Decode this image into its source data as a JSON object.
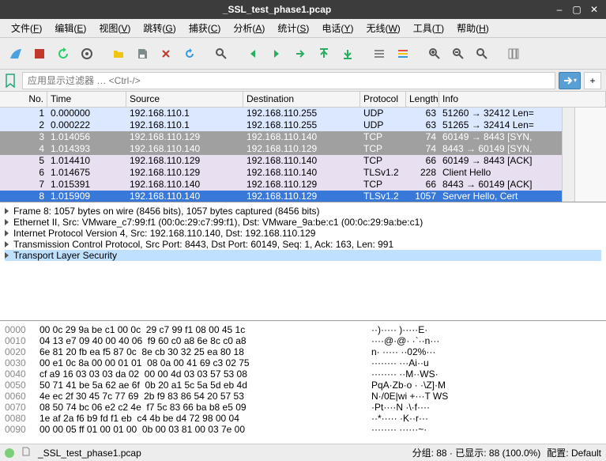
{
  "title": "_SSL_test_phase1.pcap",
  "window_btns": {
    "min": "–",
    "max": "▢",
    "close": "✕"
  },
  "menus": [
    {
      "label": "文件",
      "key": "F"
    },
    {
      "label": "编辑",
      "key": "E"
    },
    {
      "label": "视图",
      "key": "V"
    },
    {
      "label": "跳转",
      "key": "G"
    },
    {
      "label": "捕获",
      "key": "C"
    },
    {
      "label": "分析",
      "key": "A"
    },
    {
      "label": "统计",
      "key": "S"
    },
    {
      "label": "电话",
      "key": "Y"
    },
    {
      "label": "无线",
      "key": "W"
    },
    {
      "label": "工具",
      "key": "T"
    },
    {
      "label": "帮助",
      "key": "H"
    }
  ],
  "filter_placeholder": "应用显示过滤器 … <Ctrl-/>",
  "columns": {
    "no": "No.",
    "time": "Time",
    "src": "Source",
    "dst": "Destination",
    "proto": "Protocol",
    "len": "Length",
    "info": "Info"
  },
  "packets": [
    {
      "no": 1,
      "time": "0.000000",
      "src": "192.168.110.1",
      "dst": "192.168.110.255",
      "proto": "UDP",
      "len": 63,
      "info": "51260 → 32412 Len=",
      "cls": "row-udp"
    },
    {
      "no": 2,
      "time": "0.000222",
      "src": "192.168.110.1",
      "dst": "192.168.110.255",
      "proto": "UDP",
      "len": 63,
      "info": "51265 → 32414 Len=",
      "cls": "row-udp"
    },
    {
      "no": 3,
      "time": "1.014056",
      "src": "192.168.110.129",
      "dst": "192.168.110.140",
      "proto": "TCP",
      "len": 74,
      "info": "60149 → 8443 [SYN,",
      "cls": "row-grey"
    },
    {
      "no": 4,
      "time": "1.014393",
      "src": "192.168.110.140",
      "dst": "192.168.110.129",
      "proto": "TCP",
      "len": 74,
      "info": "8443 → 60149 [SYN,",
      "cls": "row-grey"
    },
    {
      "no": 5,
      "time": "1.014410",
      "src": "192.168.110.129",
      "dst": "192.168.110.140",
      "proto": "TCP",
      "len": 66,
      "info": "60149 → 8443 [ACK]",
      "cls": "row-tcp"
    },
    {
      "no": 6,
      "time": "1.014675",
      "src": "192.168.110.129",
      "dst": "192.168.110.140",
      "proto": "TLSv1.2",
      "len": 228,
      "info": "Client Hello",
      "cls": "row-tls"
    },
    {
      "no": 7,
      "time": "1.015391",
      "src": "192.168.110.140",
      "dst": "192.168.110.129",
      "proto": "TCP",
      "len": 66,
      "info": "8443 → 60149 [ACK]",
      "cls": "row-tcp"
    },
    {
      "no": 8,
      "time": "1.015909",
      "src": "192.168.110.140",
      "dst": "192.168.110.129",
      "proto": "TLSv1.2",
      "len": 1057,
      "info": "Server Hello, Cert",
      "cls": "row-sel"
    }
  ],
  "details": [
    "Frame 8: 1057 bytes on wire (8456 bits), 1057 bytes captured (8456 bits)",
    "Ethernet II, Src: VMware_c7:99:f1 (00:0c:29:c7:99:f1), Dst: VMware_9a:be:c1 (00:0c:29:9a:be:c1)",
    "Internet Protocol Version 4, Src: 192.168.110.140, Dst: 192.168.110.129",
    "Transmission Control Protocol, Src Port: 8443, Dst Port: 60149, Seq: 1, Ack: 163, Len: 991",
    "Transport Layer Security"
  ],
  "detail_selected_index": 4,
  "hex": [
    {
      "addr": "0000",
      "bytes": "00 0c 29 9a be c1 00 0c  29 c7 99 f1 08 00 45 1c",
      "ascii": "··)····· )·····E·"
    },
    {
      "addr": "0010",
      "bytes": "04 13 e7 09 40 00 40 06  f9 60 c0 a8 6e 8c c0 a8",
      "ascii": "····@·@· ·`··n···"
    },
    {
      "addr": "0020",
      "bytes": "6e 81 20 fb ea f5 87 0c  8e cb 30 32 25 ea 80 18",
      "ascii": "n· ····· ··02%···"
    },
    {
      "addr": "0030",
      "bytes": "00 e1 0c 8a 00 00 01 01  08 0a 00 41 69 c3 02 75",
      "ascii": "········ ···Ai··u"
    },
    {
      "addr": "0040",
      "bytes": "cf a9 16 03 03 03 da 02  00 00 4d 03 03 57 53 08",
      "ascii": "········ ··M··WS·"
    },
    {
      "addr": "0050",
      "bytes": "50 71 41 be 5a 62 ae 6f  0b 20 a1 5c 5a 5d eb 4d",
      "ascii": "PqA·Zb·o · ·\\Z]·M"
    },
    {
      "addr": "0060",
      "bytes": "4e ec 2f 30 45 7c 77 69  2b f9 83 86 54 20 57 53",
      "ascii": "N·/0E|wi +···T WS"
    },
    {
      "addr": "0070",
      "bytes": "08 50 74 bc 06 e2 c2 4e  f7 5c 83 66 ba b8 e5 09",
      "ascii": "·Pt····N ·\\·f····"
    },
    {
      "addr": "0080",
      "bytes": "1e af 2a f6 b9 fd f1 eb  c4 4b be d4 72 98 00 04",
      "ascii": "··*····· ·K··r···"
    },
    {
      "addr": "0090",
      "bytes": "00 00 05 ff 01 00 01 00  0b 00 03 81 00 03 7e 00",
      "ascii": "········ ······~·"
    }
  ],
  "status": {
    "file": "_SSL_test_phase1.pcap",
    "packets": "分组: 88 · 已显示: 88 (100.0%)",
    "profile": "配置: Default"
  }
}
